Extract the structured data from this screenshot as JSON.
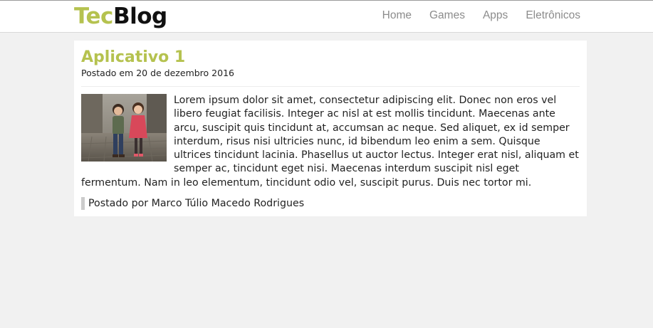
{
  "header": {
    "logo_part1": "Tec",
    "logo_part2": "Blog",
    "nav": [
      {
        "label": "Home"
      },
      {
        "label": "Games"
      },
      {
        "label": "Apps"
      },
      {
        "label": "Eletrônicos"
      }
    ]
  },
  "post": {
    "title": "Aplicativo 1",
    "date": "Postado em 20 de dezembro 2016",
    "image_icon": "children-photo",
    "body": "Lorem ipsum dolor sit amet, consectetur adipiscing elit. Donec non eros vel libero feugiat facilisis. Integer ac nisl at est mollis tincidunt. Maecenas ante arcu, suscipit quis tincidunt at, accumsan ac neque. Sed aliquet, ex id semper interdum, risus nisi ultricies nunc, id bibendum leo enim a sem. Quisque ultrices tincidunt lacinia. Phasellus ut auctor lectus. Integer erat nisl, aliquam et semper ac, tincidunt eget nisi. Maecenas interdum suscipit nisl eget fermentum. Nam in leo elementum, tincidunt odio vel, suscipit purus. Duis nec tortor mi.",
    "author": "Postado por Marco Túlio Macedo Rodrigues"
  },
  "colors": {
    "accent": "#b5c24f",
    "background": "#f1f1f1",
    "nav_text": "#8c8c8c"
  }
}
